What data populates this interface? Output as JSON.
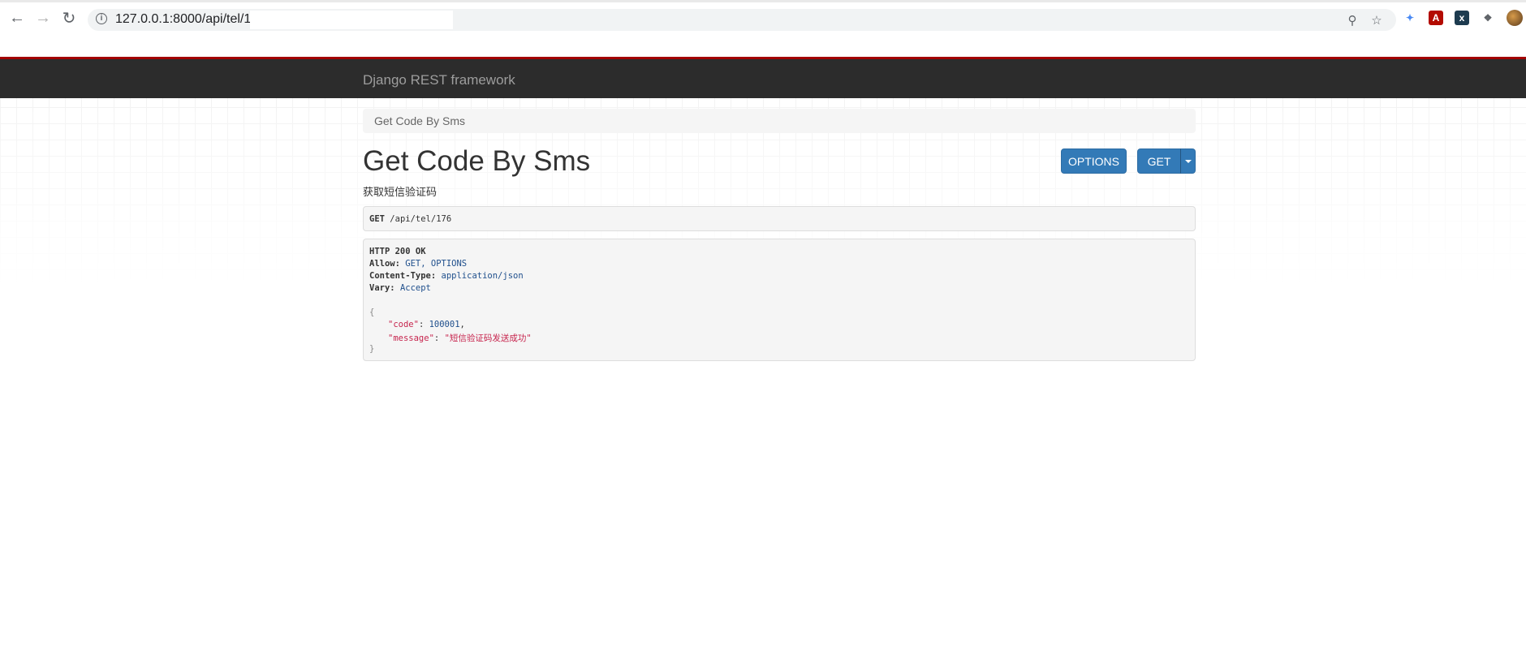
{
  "browser": {
    "url": "127.0.0.1:8000/api/tel/1",
    "icons": [
      "back-icon",
      "forward-icon",
      "reload-icon",
      "info-icon",
      "zoom-icon",
      "star-icon",
      "puzzle-icon"
    ]
  },
  "navbar": {
    "brand": "Django REST framework"
  },
  "breadcrumb": {
    "label": "Get Code By Sms"
  },
  "main": {
    "title": "Get Code By Sms",
    "description": "获取短信验证码",
    "options_label": "OPTIONS",
    "get_label": "GET"
  },
  "request": {
    "method": "GET",
    "path": "/api/tel/176"
  },
  "response": {
    "status": "HTTP 200 OK",
    "headers": [
      {
        "name": "Allow:",
        "value": "GET, OPTIONS"
      },
      {
        "name": "Content-Type:",
        "value": "application/json"
      },
      {
        "name": "Vary:",
        "value": "Accept"
      }
    ],
    "body": {
      "open": "{",
      "code_key": "\"code\"",
      "code_value": "100001",
      "message_key": "\"message\"",
      "message_value": "\"短信验证码发送成功\"",
      "close": "}"
    }
  },
  "colors": {
    "navbar_bg": "#2c2c2c",
    "navbar_accent": "#a30000",
    "button_primary": "#337ab7"
  }
}
